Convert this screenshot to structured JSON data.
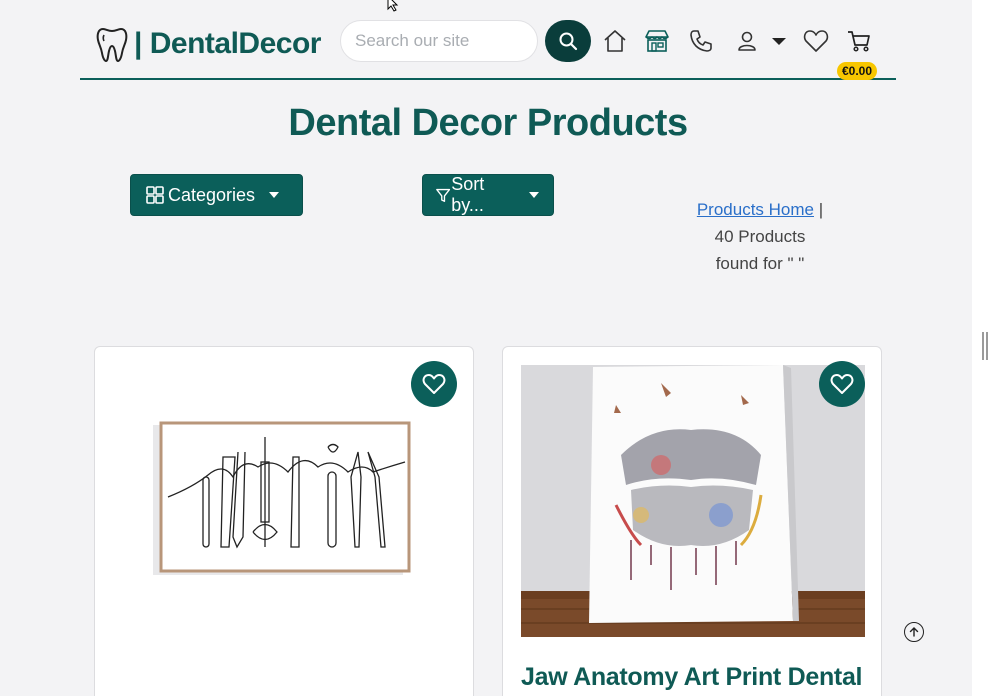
{
  "header": {
    "brand": "| DentalDecor",
    "search": {
      "placeholder": "Search our site",
      "value": ""
    },
    "cart_total": "€0.00"
  },
  "page_title": "Dental Decor Products",
  "toolbar": {
    "categories_label": "Categories",
    "sort_label": "Sort by..."
  },
  "results": {
    "home_link": "Products Home",
    "separator": "|",
    "count_text": "40 Products",
    "found_text": "found for \" \""
  },
  "products": [
    {
      "title": ""
    },
    {
      "title": "Jaw Anatomy Art Print Dental"
    }
  ],
  "colors": {
    "brand_teal": "#0b5f5a",
    "dark_teal": "#0a3d3b",
    "badge_yellow": "#f7c600",
    "background": "#f3f3f5"
  },
  "icons": [
    "tooth-logo-icon",
    "search-icon",
    "home-icon",
    "store-icon",
    "phone-icon",
    "user-icon",
    "caret-down-icon",
    "heart-icon",
    "cart-icon",
    "filter-icon",
    "grid-icon",
    "arrow-up-circle-icon"
  ]
}
